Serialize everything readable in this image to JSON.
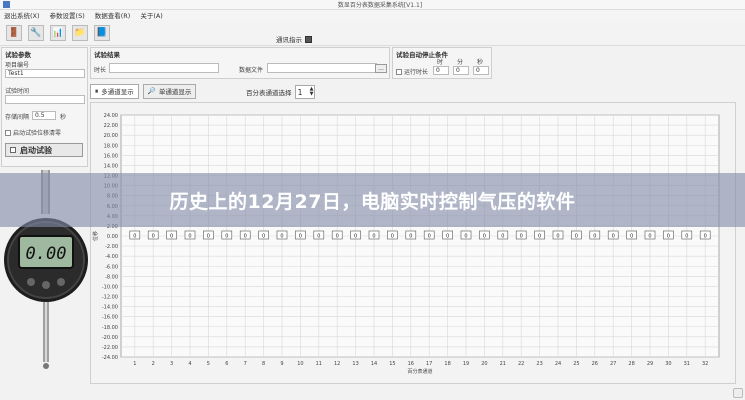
{
  "window": {
    "title": "数显百分表数据采集系统[V1.1]"
  },
  "menu": [
    "退出系统(X)",
    "参数设置(S)",
    "数据查看(R)",
    "关于(A)"
  ],
  "toolbar": {
    "comm_label": "通讯指示"
  },
  "test_params": {
    "title": "试验参数",
    "item_no_label": "项目编号",
    "item_no_value": "Test1",
    "duration_label": "试验时间",
    "interval_label": "存储间隔",
    "interval_value": "0.5",
    "interval_unit": "秒",
    "auto_zero_label": "启动试验位移清零",
    "start_button": "启动试验"
  },
  "test_result": {
    "title": "试验结果",
    "time_label": "时长",
    "datafile_label": "数据文件",
    "browse": "..."
  },
  "auto_stop": {
    "title": "试验自动停止条件",
    "run_time_label": "运行时长",
    "hour": "时",
    "minute": "分",
    "second": "秒",
    "h_value": "0",
    "m_value": "0",
    "s_value": "0"
  },
  "tabs": [
    {
      "label": "多通道显示",
      "icon": "pause-icon"
    },
    {
      "label": "单通道显示",
      "icon": "magnifier-icon"
    }
  ],
  "percent_select": {
    "label": "百分表通道选择",
    "value": "1"
  },
  "gauge": {
    "display": "0.00"
  },
  "overlay": {
    "headline": "历史上的12月27日，电脑实时控制气压的软件"
  },
  "chart_data": {
    "type": "bar",
    "ylabel": "位移",
    "xlabel": "百分表通道",
    "ylim": [
      -24,
      24
    ],
    "yticks": [
      "24.00",
      "22.00",
      "20.00",
      "18.00",
      "16.00",
      "14.00",
      "12.00",
      "10.00",
      "8.00",
      "6.00",
      "4.00",
      "2.00",
      "0.00",
      "-2.00",
      "-4.00",
      "-6.00",
      "-8.00",
      "-10.00",
      "-12.00",
      "-14.00",
      "-16.00",
      "-18.00",
      "-20.00",
      "-22.00",
      "-24.00"
    ],
    "categories": [
      "1",
      "2",
      "3",
      "4",
      "5",
      "6",
      "7",
      "8",
      "9",
      "10",
      "11",
      "12",
      "13",
      "14",
      "15",
      "16",
      "17",
      "18",
      "19",
      "20",
      "21",
      "22",
      "23",
      "24",
      "25",
      "26",
      "27",
      "28",
      "29",
      "30",
      "31",
      "32"
    ],
    "values": [
      0,
      0,
      0,
      0,
      0,
      0,
      0,
      0,
      0,
      0,
      0,
      0,
      0,
      0,
      0,
      0,
      0,
      0,
      0,
      0,
      0,
      0,
      0,
      0,
      0,
      0,
      0,
      0,
      0,
      0,
      0,
      0
    ],
    "value_labels": [
      "0",
      "0",
      "0",
      "0",
      "0",
      "0",
      "0",
      "0",
      "0",
      "0",
      "0",
      "0",
      "0",
      "0",
      "0",
      "0",
      "0",
      "0",
      "0",
      "0",
      "0",
      "0",
      "0",
      "0",
      "0",
      "0",
      "0",
      "0",
      "0",
      "0",
      "0",
      "0"
    ],
    "grid": true
  }
}
